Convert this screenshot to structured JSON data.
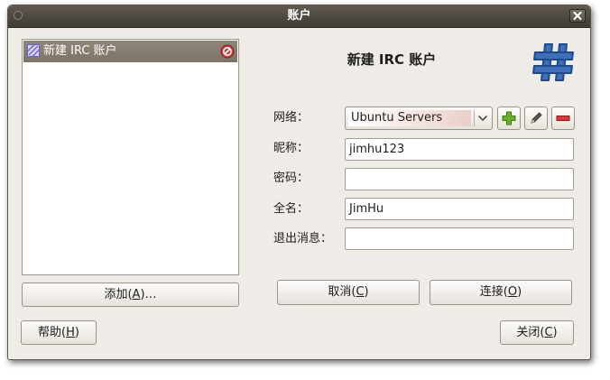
{
  "window": {
    "title": "账户"
  },
  "accounts": {
    "items": [
      {
        "label": "新建 IRC 账户"
      }
    ]
  },
  "add_button": {
    "pre": "添加(",
    "key": "A",
    "post": ")…"
  },
  "help_button": {
    "pre": "帮助(",
    "key": "H",
    "post": ")"
  },
  "form": {
    "title": "新建 IRC 账户",
    "network_label": "网络：",
    "network_value": "Ubuntu Servers",
    "nickname_label": "昵称：",
    "nickname_value": "jimhu123",
    "password_label": "密码：",
    "password_value": "",
    "fullname_label": "全名：",
    "fullname_value": "JimHu",
    "quit_label": "退出消息：",
    "quit_value": ""
  },
  "cancel_button": {
    "pre": "取消(",
    "key": "C",
    "post": ")"
  },
  "connect_button": {
    "pre": "连接(",
    "key": "O",
    "post": ")"
  },
  "close_button": {
    "pre": "关闭(",
    "key": "C",
    "post": ")"
  },
  "colors": {
    "accent": "#3e6fb8",
    "selection": "#857c70",
    "titlebar": "#4c4740",
    "add": "#5fa31f",
    "remove": "#d32f2f"
  }
}
